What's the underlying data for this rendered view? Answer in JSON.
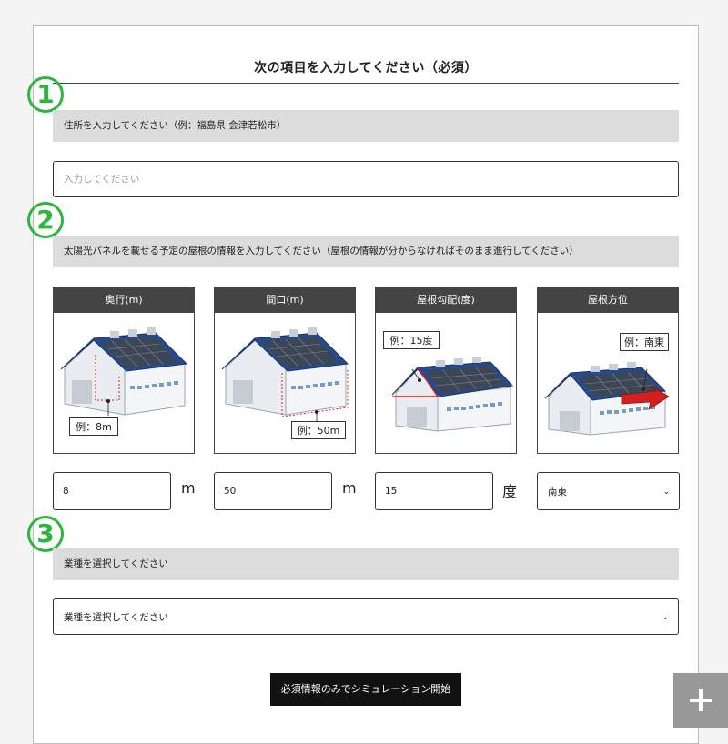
{
  "form": {
    "title": "次の項目を入力してください（必須）",
    "steps": [
      "1",
      "2",
      "3"
    ],
    "address": {
      "label": "住所を入力してください（例：福島県 会津若松市）",
      "placeholder": "入力してください"
    },
    "roof": {
      "label": "太陽光パネルを載せる予定の屋根の情報を入力してください（屋根の情報が分からなければそのまま進行してください）",
      "cards": [
        {
          "header": "奥行(m)",
          "example": "例：8m"
        },
        {
          "header": "間口(m)",
          "example": "例：50m"
        },
        {
          "header": "屋根勾配(度)",
          "example": "例：15度"
        },
        {
          "header": "屋根方位",
          "example": "例：南東"
        }
      ],
      "depth_value": "8",
      "depth_unit": "m",
      "width_value": "50",
      "width_unit": "m",
      "pitch_value": "15",
      "pitch_unit": "度",
      "direction_value": "南東"
    },
    "industry": {
      "label": "業種を選択してください",
      "selected": "業種を選択してください"
    },
    "submit_label": "必須情報のみでシミュレーション開始"
  },
  "icons": {
    "chevron": "chevron-down-icon",
    "plus": "plus-icon"
  },
  "colors": {
    "accent_green": "#2db53d",
    "header_dark": "#444444",
    "label_bar": "#dcdcdc",
    "marker_red": "#d42020"
  }
}
